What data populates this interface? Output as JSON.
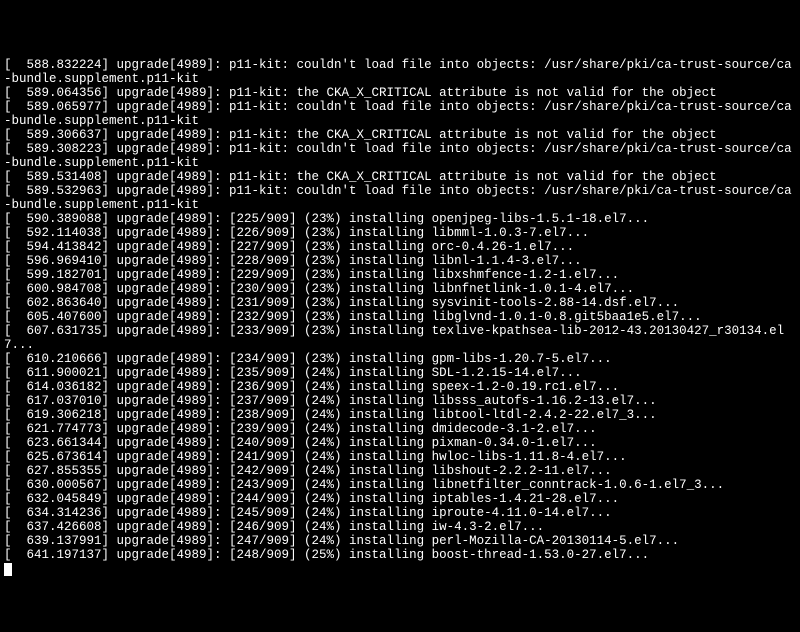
{
  "lines": [
    "[  588.832224] upgrade[4989]: p11-kit: couldn't load file into objects: /usr/share/pki/ca-trust-source/ca-bundle.supplement.p11-kit",
    "[  589.064356] upgrade[4989]: p11-kit: the CKA_X_CRITICAL attribute is not valid for the object",
    "[  589.065977] upgrade[4989]: p11-kit: couldn't load file into objects: /usr/share/pki/ca-trust-source/ca-bundle.supplement.p11-kit",
    "[  589.306637] upgrade[4989]: p11-kit: the CKA_X_CRITICAL attribute is not valid for the object",
    "[  589.308223] upgrade[4989]: p11-kit: couldn't load file into objects: /usr/share/pki/ca-trust-source/ca-bundle.supplement.p11-kit",
    "[  589.531408] upgrade[4989]: p11-kit: the CKA_X_CRITICAL attribute is not valid for the object",
    "[  589.532963] upgrade[4989]: p11-kit: couldn't load file into objects: /usr/share/pki/ca-trust-source/ca-bundle.supplement.p11-kit",
    "[  590.389088] upgrade[4989]: [225/909] (23%) installing openjpeg-libs-1.5.1-18.el7...",
    "[  592.114038] upgrade[4989]: [226/909] (23%) installing libmml-1.0.3-7.el7...",
    "[  594.413842] upgrade[4989]: [227/909] (23%) installing orc-0.4.26-1.el7...",
    "[  596.969410] upgrade[4989]: [228/909] (23%) installing libnl-1.1.4-3.el7...",
    "[  599.182701] upgrade[4989]: [229/909] (23%) installing libxshmfence-1.2-1.el7...",
    "[  600.984708] upgrade[4989]: [230/909] (23%) installing libnfnetlink-1.0.1-4.el7...",
    "[  602.863640] upgrade[4989]: [231/909] (23%) installing sysvinit-tools-2.88-14.dsf.el7...",
    "[  605.407600] upgrade[4989]: [232/909] (23%) installing libglvnd-1.0.1-0.8.git5baa1e5.el7...",
    "[  607.631735] upgrade[4989]: [233/909] (23%) installing texlive-kpathsea-lib-2012-43.20130427_r30134.el7...",
    "[  610.210666] upgrade[4989]: [234/909] (23%) installing gpm-libs-1.20.7-5.el7...",
    "[  611.900021] upgrade[4989]: [235/909] (24%) installing SDL-1.2.15-14.el7...",
    "[  614.036182] upgrade[4989]: [236/909] (24%) installing speex-1.2-0.19.rc1.el7...",
    "[  617.037010] upgrade[4989]: [237/909] (24%) installing libsss_autofs-1.16.2-13.el7...",
    "[  619.306218] upgrade[4989]: [238/909] (24%) installing libtool-ltdl-2.4.2-22.el7_3...",
    "[  621.774773] upgrade[4989]: [239/909] (24%) installing dmidecode-3.1-2.el7...",
    "[  623.661344] upgrade[4989]: [240/909] (24%) installing pixman-0.34.0-1.el7...",
    "[  625.673614] upgrade[4989]: [241/909] (24%) installing hwloc-libs-1.11.8-4.el7...",
    "[  627.855355] upgrade[4989]: [242/909] (24%) installing libshout-2.2.2-11.el7...",
    "[  630.000567] upgrade[4989]: [243/909] (24%) installing libnetfilter_conntrack-1.0.6-1.el7_3...",
    "[  632.045849] upgrade[4989]: [244/909] (24%) installing iptables-1.4.21-28.el7...",
    "[  634.314236] upgrade[4989]: [245/909] (24%) installing iproute-4.11.0-14.el7...",
    "[  637.426608] upgrade[4989]: [246/909] (24%) installing iw-4.3-2.el7...",
    "[  639.137991] upgrade[4989]: [247/909] (24%) installing perl-Mozilla-CA-20130114-5.el7...",
    "[  641.197137] upgrade[4989]: [248/909] (25%) installing boost-thread-1.53.0-27.el7..."
  ]
}
